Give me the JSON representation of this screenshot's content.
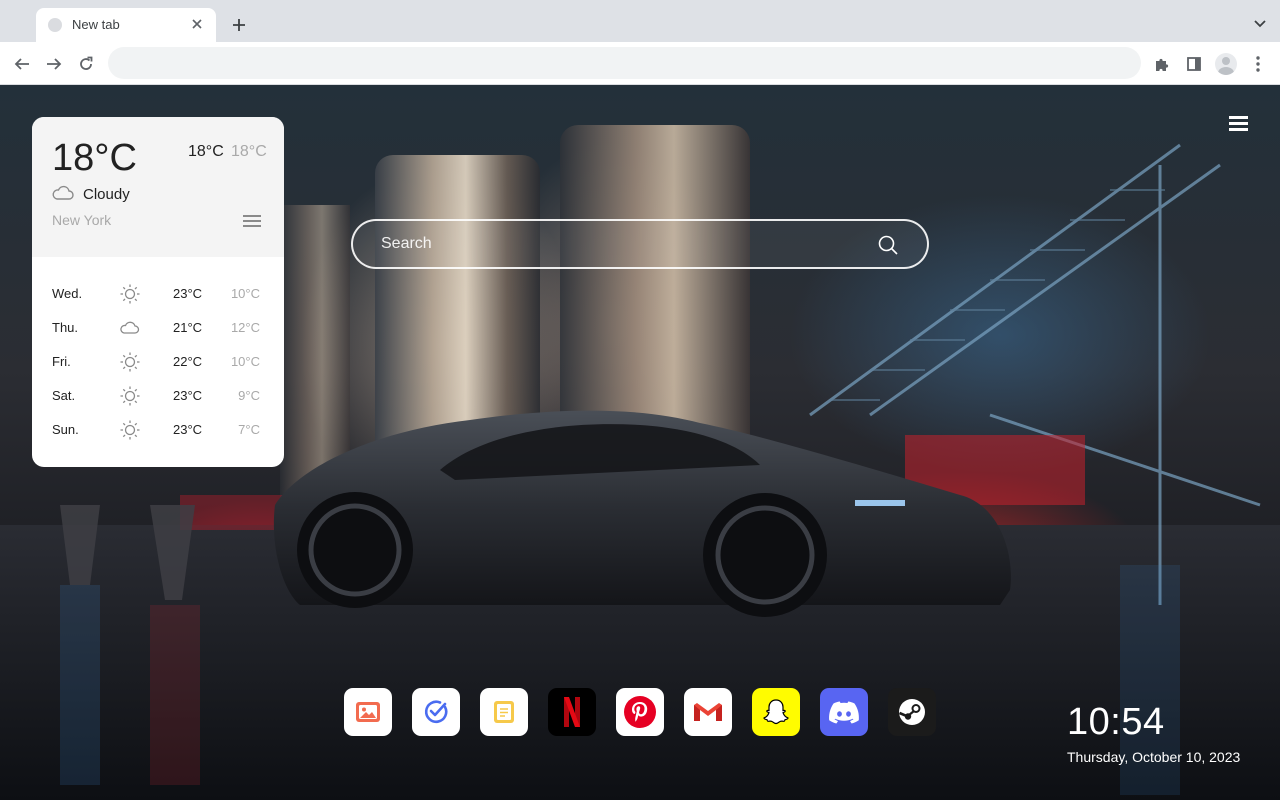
{
  "browser": {
    "tab_title": "New tab",
    "omnibox_value": ""
  },
  "weather": {
    "current_temp": "18°C",
    "high": "18°C",
    "low": "18°C",
    "condition": "Cloudy",
    "condition_icon": "cloud-icon",
    "city": "New York",
    "forecast": [
      {
        "day": "Wed.",
        "icon": "sun-icon",
        "high": "23°C",
        "low": "10°C"
      },
      {
        "day": "Thu.",
        "icon": "cloud-icon",
        "high": "21°C",
        "low": "12°C"
      },
      {
        "day": "Fri.",
        "icon": "sun-icon",
        "high": "22°C",
        "low": "10°C"
      },
      {
        "day": "Sat.",
        "icon": "sun-icon",
        "high": "23°C",
        "low": "9°C"
      },
      {
        "day": "Sun.",
        "icon": "sun-icon",
        "high": "23°C",
        "low": "7°C"
      }
    ]
  },
  "search": {
    "placeholder": "Search"
  },
  "dock": {
    "apps": [
      {
        "name": "photos",
        "icon": "photos-icon",
        "bg": "#ffffff"
      },
      {
        "name": "tasks",
        "icon": "check-icon",
        "bg": "#ffffff"
      },
      {
        "name": "notes",
        "icon": "notes-icon",
        "bg": "#ffffff"
      },
      {
        "name": "netflix",
        "icon": "netflix-icon",
        "bg": "#000000"
      },
      {
        "name": "pinterest",
        "icon": "pinterest-icon",
        "bg": "#ffffff"
      },
      {
        "name": "gmail",
        "icon": "gmail-icon",
        "bg": "#ffffff"
      },
      {
        "name": "snapchat",
        "icon": "snapchat-icon",
        "bg": "#fffc00"
      },
      {
        "name": "discord",
        "icon": "discord-icon",
        "bg": "#5865f2"
      },
      {
        "name": "steam",
        "icon": "steam-icon",
        "bg": "#1b1b1b"
      }
    ]
  },
  "clock": {
    "time": "10:54",
    "date": "Thursday, October 10, 2023"
  },
  "colors": {
    "chrome_tabstrip": "#dee1e6",
    "omnibox": "#f1f3f4",
    "widget_bg": "#ffffff",
    "muted_text": "#a9a9a9",
    "accent_red": "#e50914",
    "pinterest_red": "#e60023",
    "discord_blue": "#5865f2",
    "snapchat_yellow": "#fffc00"
  }
}
